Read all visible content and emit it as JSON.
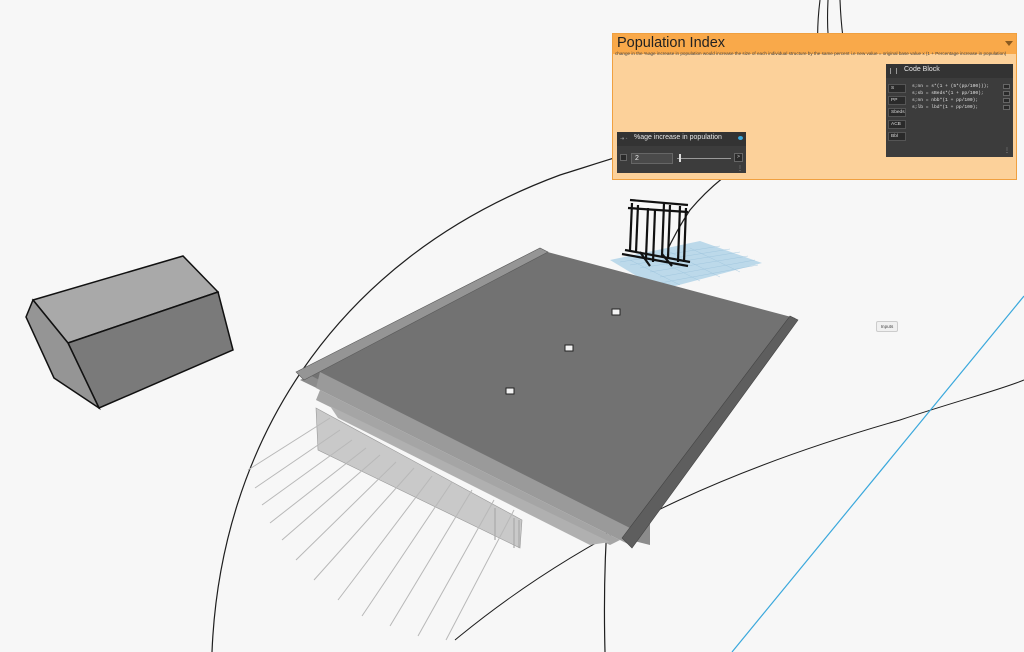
{
  "group": {
    "title": "Population Index",
    "description": "change in the %age increase in population would increase the size of each individual structure by the same percent i.e new value = original base value x (1 + Percentage increase in population)"
  },
  "code_block": {
    "title": "Code Block",
    "inputs": [
      "S",
      "PP",
      "Sbeds",
      "ACB",
      "Bbl"
    ],
    "lines": [
      "s;nn = s*(1 + (5*(pp/100)));",
      "s;sb = sBeds*(1 + pp/100);",
      "s;nn = nbb*(1 + pp/100);",
      "s;lb = lbd*(1 + pp/100);"
    ]
  },
  "slider": {
    "title": "%age increase in population",
    "value": "2"
  },
  "viewport": {
    "badge_label": "Inputs"
  },
  "colors": {
    "group_header": "#f9a94a",
    "group_body": "#fcd19a",
    "node_body": "#3c3c3c",
    "wire": "#222222",
    "accent_line": "#3aa8dc"
  }
}
